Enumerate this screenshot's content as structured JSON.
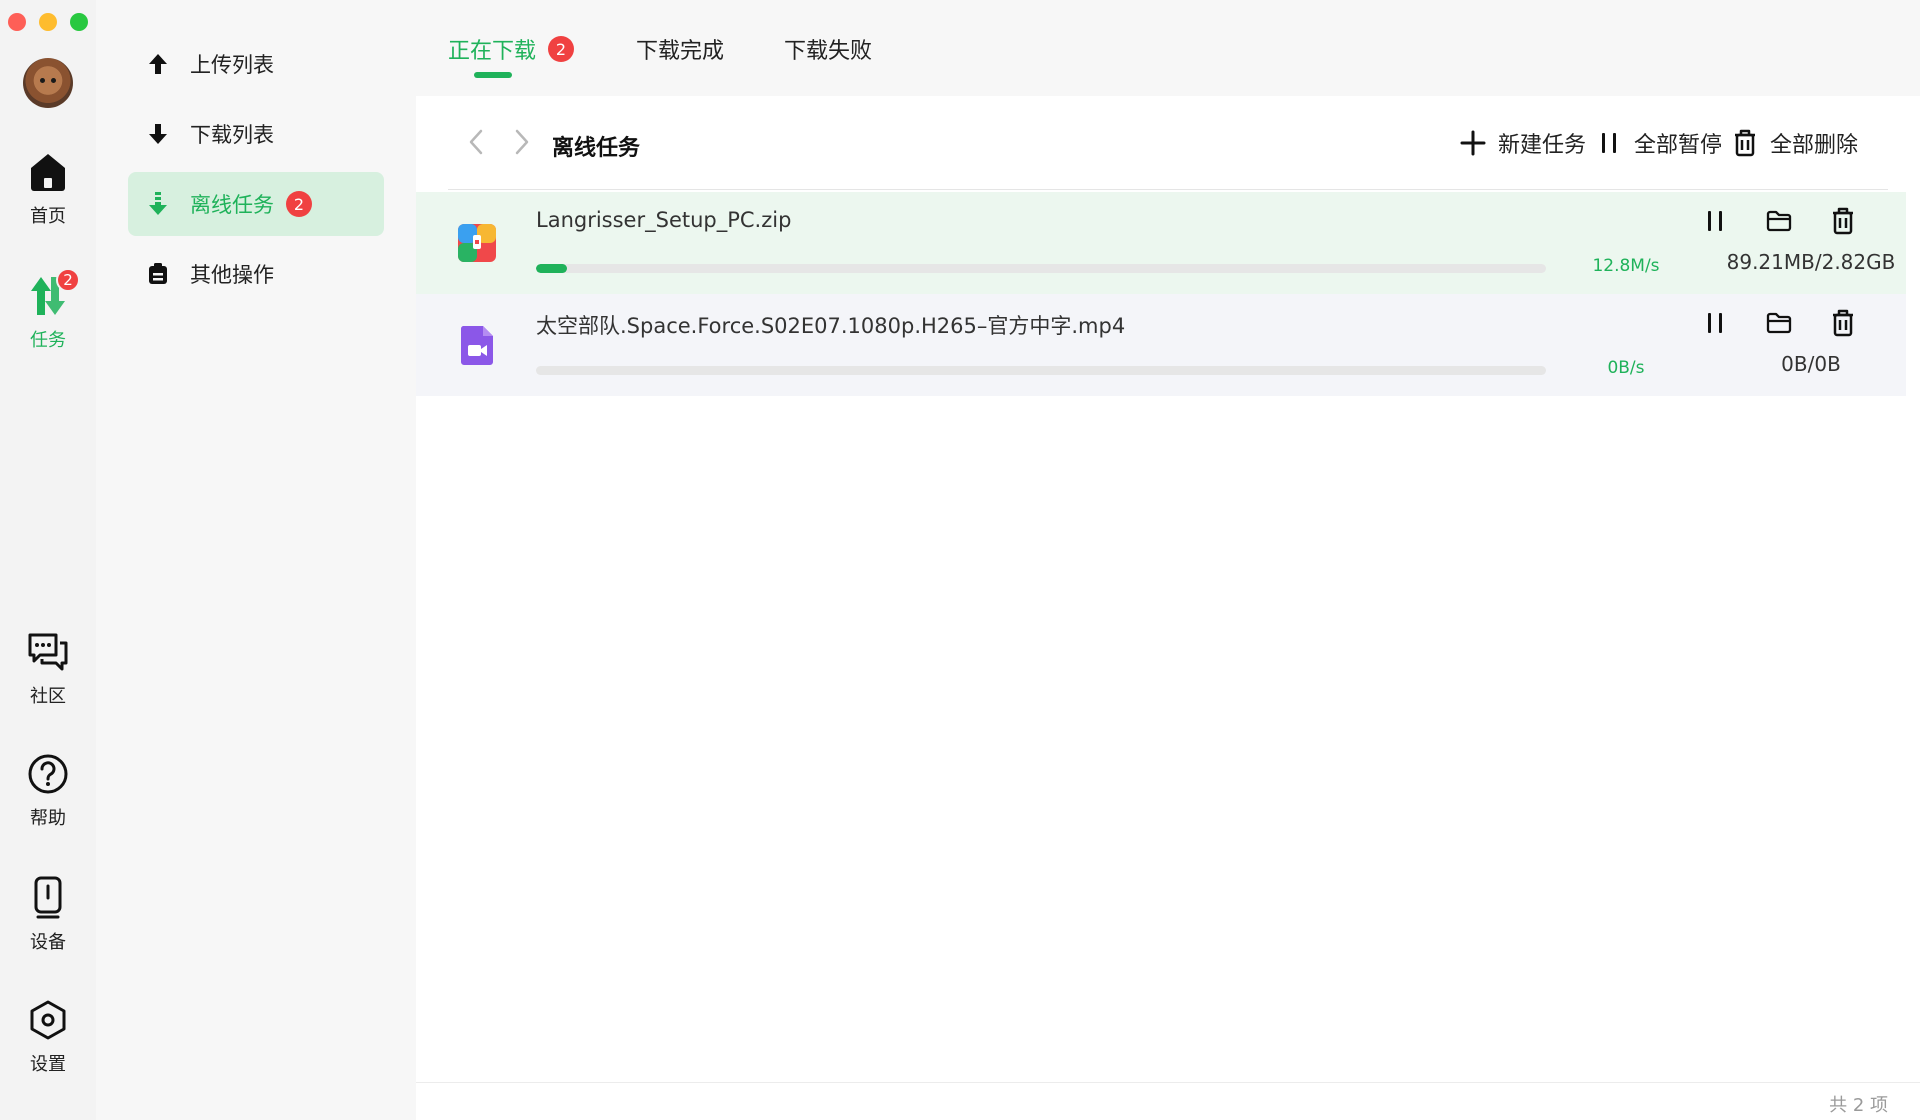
{
  "window": {
    "controls": [
      "close",
      "minimize",
      "maximize"
    ]
  },
  "rail": {
    "items": [
      {
        "label": "首页",
        "icon": "home-icon"
      },
      {
        "label": "任务",
        "icon": "transfer-icon",
        "badge": "2",
        "active": true
      },
      {
        "label": "社区",
        "icon": "chat-icon"
      },
      {
        "label": "帮助",
        "icon": "help-icon"
      },
      {
        "label": "设备",
        "icon": "device-icon"
      },
      {
        "label": "设置",
        "icon": "settings-icon"
      }
    ]
  },
  "sidebar": {
    "items": [
      {
        "label": "上传列表",
        "icon": "upload-arrow-icon"
      },
      {
        "label": "下载列表",
        "icon": "download-arrow-icon"
      },
      {
        "label": "离线任务",
        "icon": "offline-download-icon",
        "badge": "2",
        "active": true
      },
      {
        "label": "其他操作",
        "icon": "clipboard-icon"
      }
    ]
  },
  "tabs": [
    {
      "label": "正在下载",
      "badge": "2",
      "active": true
    },
    {
      "label": "下载完成"
    },
    {
      "label": "下载失败"
    }
  ],
  "toolbar": {
    "title": "离线任务",
    "new_task": "新建任务",
    "pause_all": "全部暂停",
    "delete_all": "全部删除"
  },
  "tasks": [
    {
      "name": "Langrisser_Setup_PC.zip",
      "speed": "12.8M/s",
      "size": "89.21MB/2.82GB",
      "progress": 0.031,
      "file_type_icon": "archive-file-icon"
    },
    {
      "name": "太空部队.Space.Force.S02E07.1080p.H265–官方中字.mp4",
      "speed": "0B/s",
      "size": "0B/0B",
      "progress": 0,
      "file_type_icon": "video-file-icon"
    }
  ],
  "footer": {
    "count": "共 2 项"
  },
  "colors": {
    "accent": "#1fb25a",
    "badge": "#f04141",
    "active_bg": "#d7f0df"
  }
}
